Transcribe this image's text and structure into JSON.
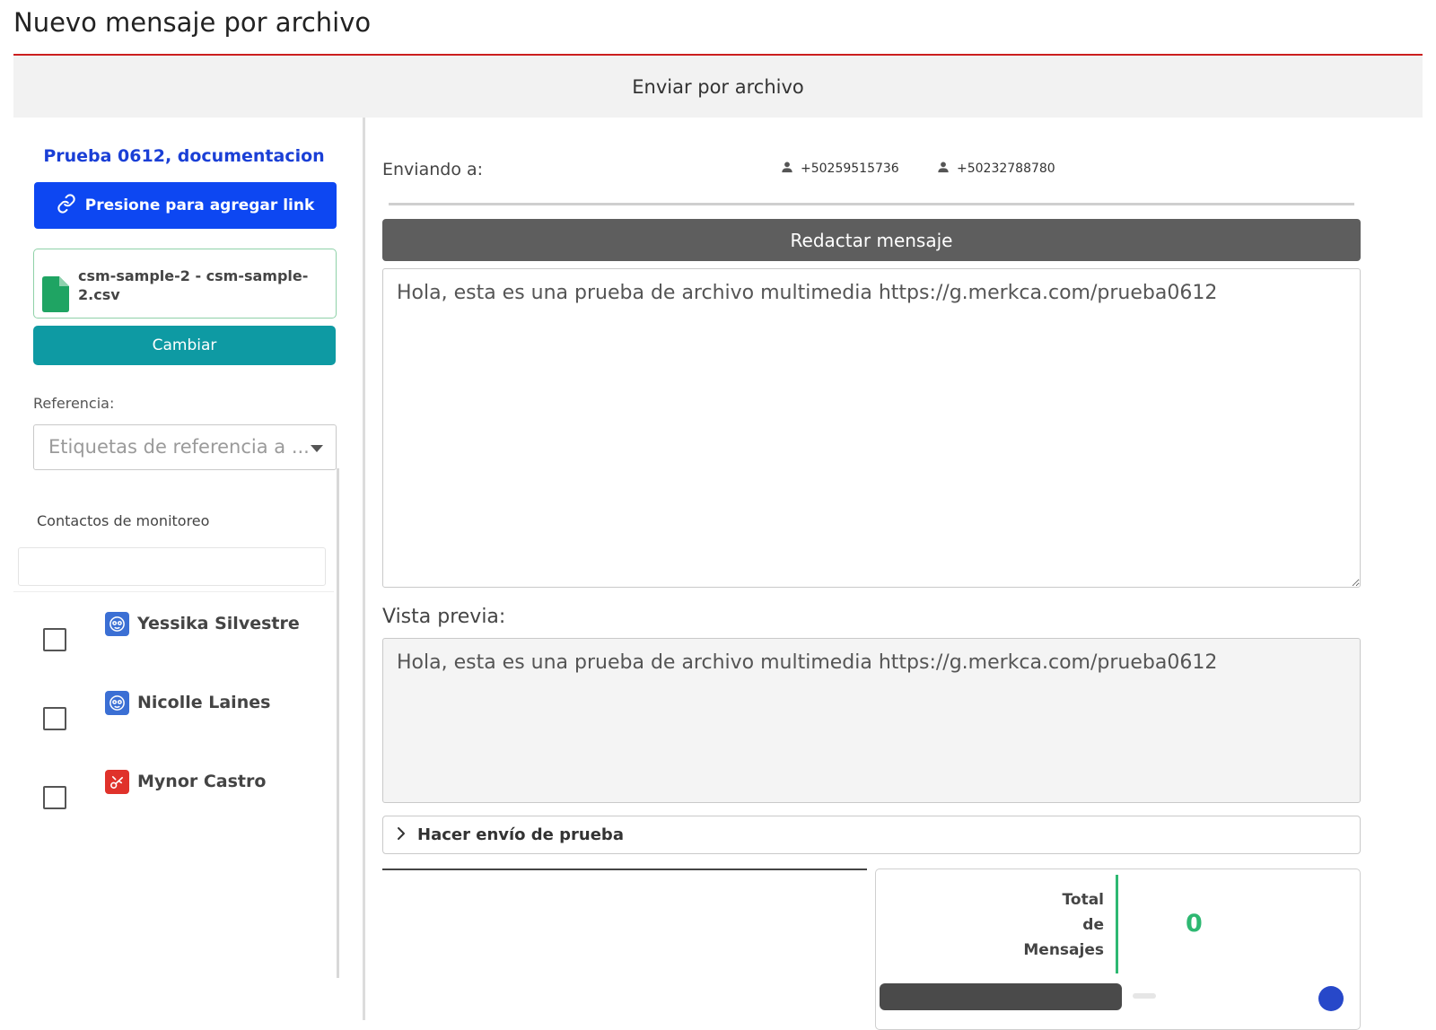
{
  "page": {
    "title": "Nuevo mensaje por archivo"
  },
  "tabs": {
    "active": "Enviar por archivo"
  },
  "left": {
    "campaign_name": "Prueba 0612, documentacion",
    "add_link_label": "Presione para agregar link",
    "file": {
      "name": "csm-sample-2 - csm-sample-2.csv"
    },
    "change_label": "Cambiar",
    "reference": {
      "label": "Referencia:",
      "placeholder": "Etiquetas de referencia a ..."
    },
    "monitoring": {
      "label": "Contactos de monitoreo",
      "search_value": "",
      "contacts": [
        {
          "name": "Yessika Silvestre",
          "badge_color": "#3b6fd4",
          "icon": "face-icon",
          "checked": false
        },
        {
          "name": "Nicolle Laines",
          "badge_color": "#3b6fd4",
          "icon": "face-icon",
          "checked": false
        },
        {
          "name": "Mynor Castro",
          "badge_color": "#e0322b",
          "icon": "tool-icon",
          "checked": false
        }
      ]
    }
  },
  "right": {
    "sending_label": "Enviando a:",
    "recipients": [
      "+50259515736",
      "+50232788780"
    ],
    "compose_title": "Redactar mensaje",
    "message": "Hola, esta es una prueba de archivo multimedia https://g.merkca.com/prueba0612",
    "preview_label": "Vista previa:",
    "preview": "Hola, esta es una prueba de archivo multimedia https://g.merkca.com/prueba0612",
    "test_send_label": "Hacer envío de prueba",
    "totals": {
      "label_line1": "Total",
      "label_line2": "de",
      "label_line3": "Mensajes",
      "value": "0"
    }
  },
  "colors": {
    "accent_red": "#cc1f1f",
    "primary_blue": "#0d47f2",
    "teal": "#0e9aa3",
    "success_green": "#2eb872",
    "campaign_blue": "#1a3fd6"
  }
}
